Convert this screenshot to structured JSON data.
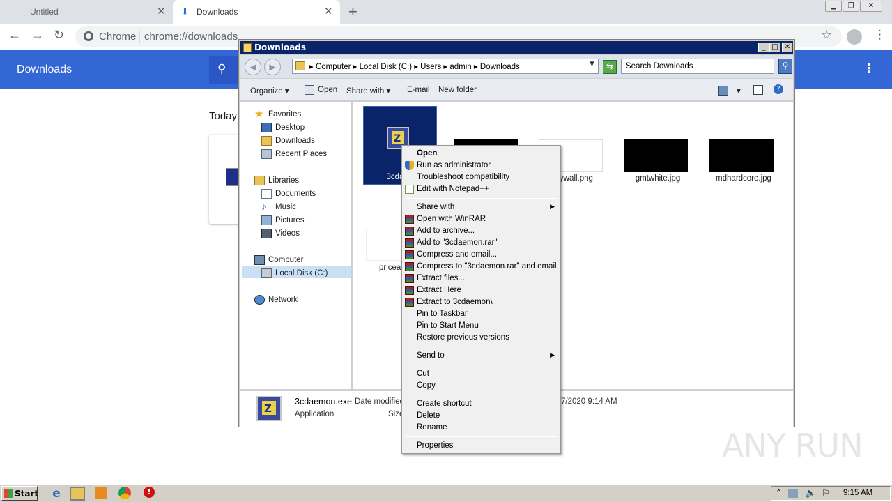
{
  "browser": {
    "tabs": [
      {
        "label": "Untitled"
      },
      {
        "label": "Downloads"
      }
    ],
    "omnibox": {
      "site": "Chrome",
      "url": "chrome://downloads"
    },
    "page": {
      "title": "Downloads",
      "section": "Today"
    }
  },
  "explorer": {
    "title": "Downloads",
    "address": "▸  Computer  ▸  Local Disk (C:)  ▸  Users  ▸  admin  ▸  Downloads",
    "search_placeholder": "Search Downloads",
    "commands": {
      "organize": "Organize",
      "open": "Open",
      "share_with": "Share with",
      "email": "E-mail",
      "new_folder": "New folder"
    },
    "nav": {
      "favorites": "Favorites",
      "desktop": "Desktop",
      "downloads": "Downloads",
      "recent_places": "Recent Places",
      "libraries": "Libraries",
      "documents": "Documents",
      "music": "Music",
      "pictures": "Pictures",
      "videos": "Videos",
      "computer": "Computer",
      "local_disk": "Local Disk (C:)",
      "network": "Network"
    },
    "files": [
      {
        "name": "3cdaem"
      },
      {
        "name": ""
      },
      {
        "name": "ywall.png"
      },
      {
        "name": "gmtwhite.jpg"
      },
      {
        "name": "mdhardcore.jpg"
      },
      {
        "name": "priceai"
      }
    ],
    "details": {
      "name": "3cdaemon.exe",
      "date_label": "Date modified",
      "type": "Application",
      "size_label": "Size",
      "date_value": "7/2020 9:14 AM"
    }
  },
  "context_menu": {
    "open": "Open",
    "run_as_admin": "Run as administrator",
    "troubleshoot": "Troubleshoot compatibility",
    "edit_notepad": "Edit with Notepad++",
    "share_with": "Share with",
    "open_winrar": "Open with WinRAR",
    "add_archive": "Add to archive...",
    "add_to_rar": "Add to \"3cdaemon.rar\"",
    "compress_email": "Compress and email...",
    "compress_rar_email": "Compress to \"3cdaemon.rar\" and email",
    "extract_files": "Extract files...",
    "extract_here": "Extract Here",
    "extract_to": "Extract to 3cdaemon\\",
    "pin_taskbar": "Pin to Taskbar",
    "pin_start": "Pin to Start Menu",
    "restore": "Restore previous versions",
    "send_to": "Send to",
    "cut": "Cut",
    "copy": "Copy",
    "create_shortcut": "Create shortcut",
    "delete": "Delete",
    "rename": "Rename",
    "properties": "Properties"
  },
  "watermark": "ANY RUN",
  "taskbar": {
    "start": "Start",
    "clock": "9:15 AM"
  },
  "colors": {
    "chrome_header": "#3367d6",
    "selection": "#0a246a",
    "explorer_title": "#0a246a"
  }
}
